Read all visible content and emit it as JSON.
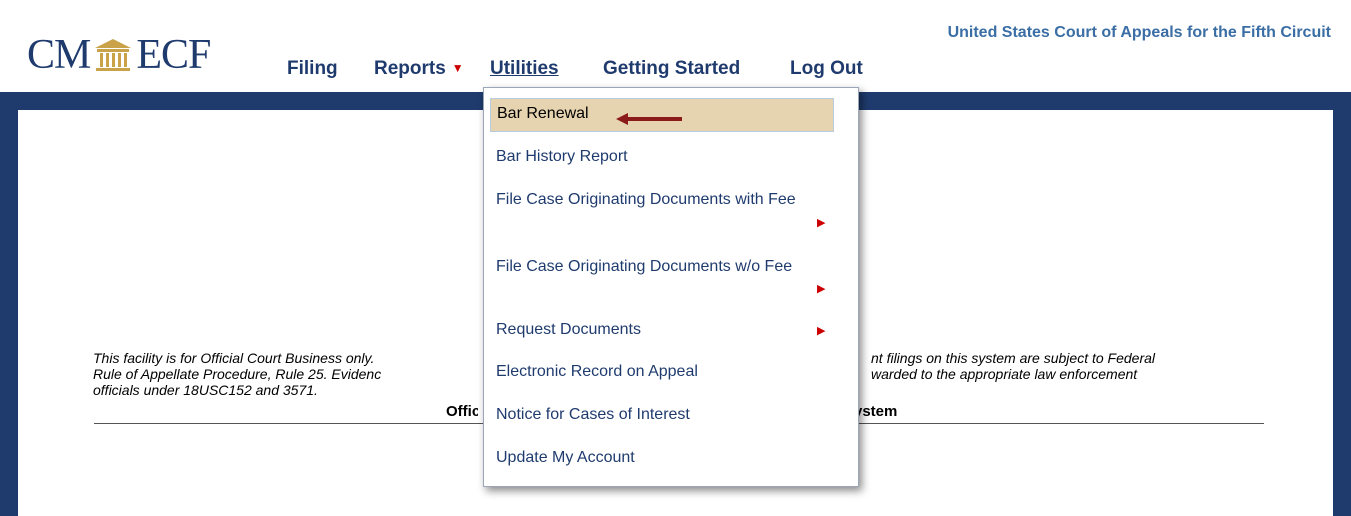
{
  "header": {
    "logo": {
      "left": "CM",
      "right": "ECF"
    },
    "nav": [
      {
        "label": "Filing"
      },
      {
        "label": "Reports"
      },
      {
        "label": "Utilities"
      },
      {
        "label": "Getting Started"
      },
      {
        "label": "Log Out"
      }
    ],
    "court_title": "United States Court of Appeals for the Fifth Circuit"
  },
  "utilities_menu": {
    "items": [
      {
        "label": "Bar Renewal",
        "selected": true
      },
      {
        "label": "Bar History Report"
      },
      {
        "label": "File Case Originating Documents with Fee",
        "has_submenu": true
      },
      {
        "label": "File Case Originating Documents w/o Fee",
        "has_submenu": true
      },
      {
        "label": "Request Documents",
        "has_submenu": true
      },
      {
        "label": "Electronic Record on Appeal"
      },
      {
        "label": "Notice for Cases of Interest"
      },
      {
        "label": "Update My Account"
      }
    ]
  },
  "main": {
    "notice_heading_left": "Offic",
    "notice_heading_right": "ystem",
    "disclaimer_lines": [
      {
        "left": "This facility is for Official Court Business only.",
        "right": "nt filings on this system are subject to Federal"
      },
      {
        "left": "Rule of Appellate Procedure, Rule 25. Evidenc",
        "right": "warded to the appropriate law enforcement"
      },
      {
        "left": "officials under 18USC152 and 3571.",
        "right": ""
      }
    ]
  },
  "colors": {
    "navy": "#1f3b6e",
    "link_blue": "#3a6ea5",
    "caret_red": "#cc0000",
    "highlight": "#e6d3b0",
    "annotation_arrow": "#8b1a1a"
  }
}
